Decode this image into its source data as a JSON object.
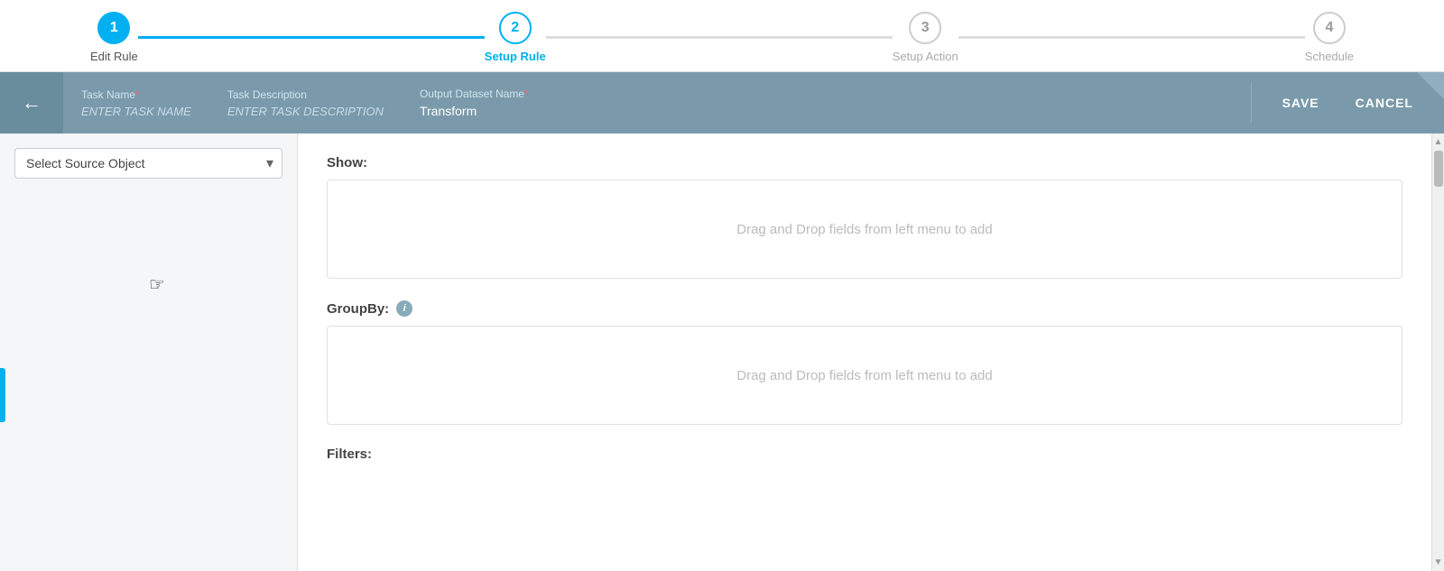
{
  "stepper": {
    "steps": [
      {
        "number": "1",
        "label": "Edit Rule",
        "state": "completed"
      },
      {
        "number": "2",
        "label": "Setup Rule",
        "state": "current"
      },
      {
        "number": "3",
        "label": "Setup Action",
        "state": "upcoming"
      },
      {
        "number": "4",
        "label": "Schedule",
        "state": "upcoming"
      }
    ]
  },
  "header": {
    "back_label": "←",
    "task_name_label": "Task Name",
    "task_name_required": "*",
    "task_name_placeholder": "ENTER TASK NAME",
    "task_description_label": "Task Description",
    "task_description_placeholder": "ENTER TASK DESCRIPTION",
    "output_dataset_label": "Output Dataset Name",
    "output_dataset_required": "*",
    "output_dataset_value": "Transform",
    "save_label": "SAVE",
    "cancel_label": "CANCEL"
  },
  "left_panel": {
    "source_select_placeholder": "Select Source Object",
    "source_select_options": [
      "Select Source Object"
    ]
  },
  "right_panel": {
    "show_label": "Show:",
    "show_drop_hint": "Drag and Drop fields from left menu to add",
    "groupby_label": "GroupBy:",
    "groupby_drop_hint": "Drag and Drop fields from left menu to add",
    "filters_label": "Filters:"
  }
}
